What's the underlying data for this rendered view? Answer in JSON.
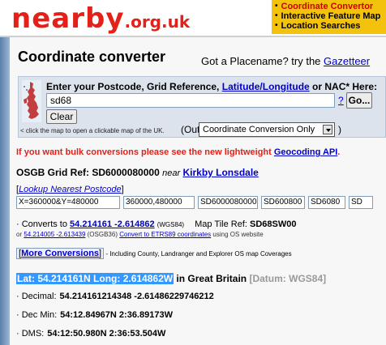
{
  "header": {
    "logo_main": "nearby",
    "logo_suffix": ".org.uk",
    "links": [
      "Coordinate Convertor",
      "Interactive Feature Map",
      "Location Searches"
    ]
  },
  "page": {
    "title": "Coordinate converter",
    "placename_text": "Got a Placename? try the ",
    "placename_link": "Gazetteer"
  },
  "form": {
    "prompt_start": "Enter your Postcode, Grid Reference, ",
    "prompt_link": "Latitude/Longitude",
    "prompt_end": " or NAC* Here:",
    "input_value": "sd68",
    "help_mark": "?",
    "go_label": "Go...",
    "clear_label": "Clear",
    "map_note": "< click the map to open a clickable map of the UK.",
    "output_label": "(Output:",
    "output_selected": "Coordinate Conversion Only",
    "close_paren": ")"
  },
  "bulk": {
    "text": "If you want bulk conversions please see the new lightweight ",
    "link": "Geocoding API",
    "end": "."
  },
  "gridref": {
    "label": "OSGB Grid Ref: SD6000080000",
    "near": "near",
    "place": "Kirkby Lonsdale"
  },
  "lookup": {
    "open": "[",
    "link": "Lookup Nearest Postcode",
    "close": "]"
  },
  "fields": [
    "X=360000&Y=480000",
    "360000,480000",
    "SD6000080000",
    "SD600800",
    "SD6080",
    "SD"
  ],
  "converts": {
    "prefix": "Converts to ",
    "link": "54.214161 -2.614862",
    "wgs": "(WGS84)",
    "tile_label": "Map Tile Ref: ",
    "tile_value": "SD68SW00",
    "osgb_pre": "or ",
    "osgb_link": "54.214005 -2.613439",
    "osgb_mid": " (OSGB36) ",
    "etrs_link": "Convert to ETRS89 coordinates",
    "etrs_end": " using OS website"
  },
  "more": {
    "open": "[",
    "link": "More Conversions",
    "close": "]",
    "desc": " - Including County, Landranger and Explorer OS map Coverages"
  },
  "latlong": {
    "highlight": "Lat: 54.214161N Long: 2.614862W",
    "country": " in Great Britain ",
    "datum": "[Datum: WGS84]"
  },
  "coords": [
    {
      "label": "Decimal:",
      "value": "54.214161214348 -2.61486229746212"
    },
    {
      "label": "Dec Min:",
      "value": "54:12.84967N 2:36.89173W"
    },
    {
      "label": "DMS:",
      "value": "54:12:50.980N 2:36:53.504W"
    }
  ]
}
